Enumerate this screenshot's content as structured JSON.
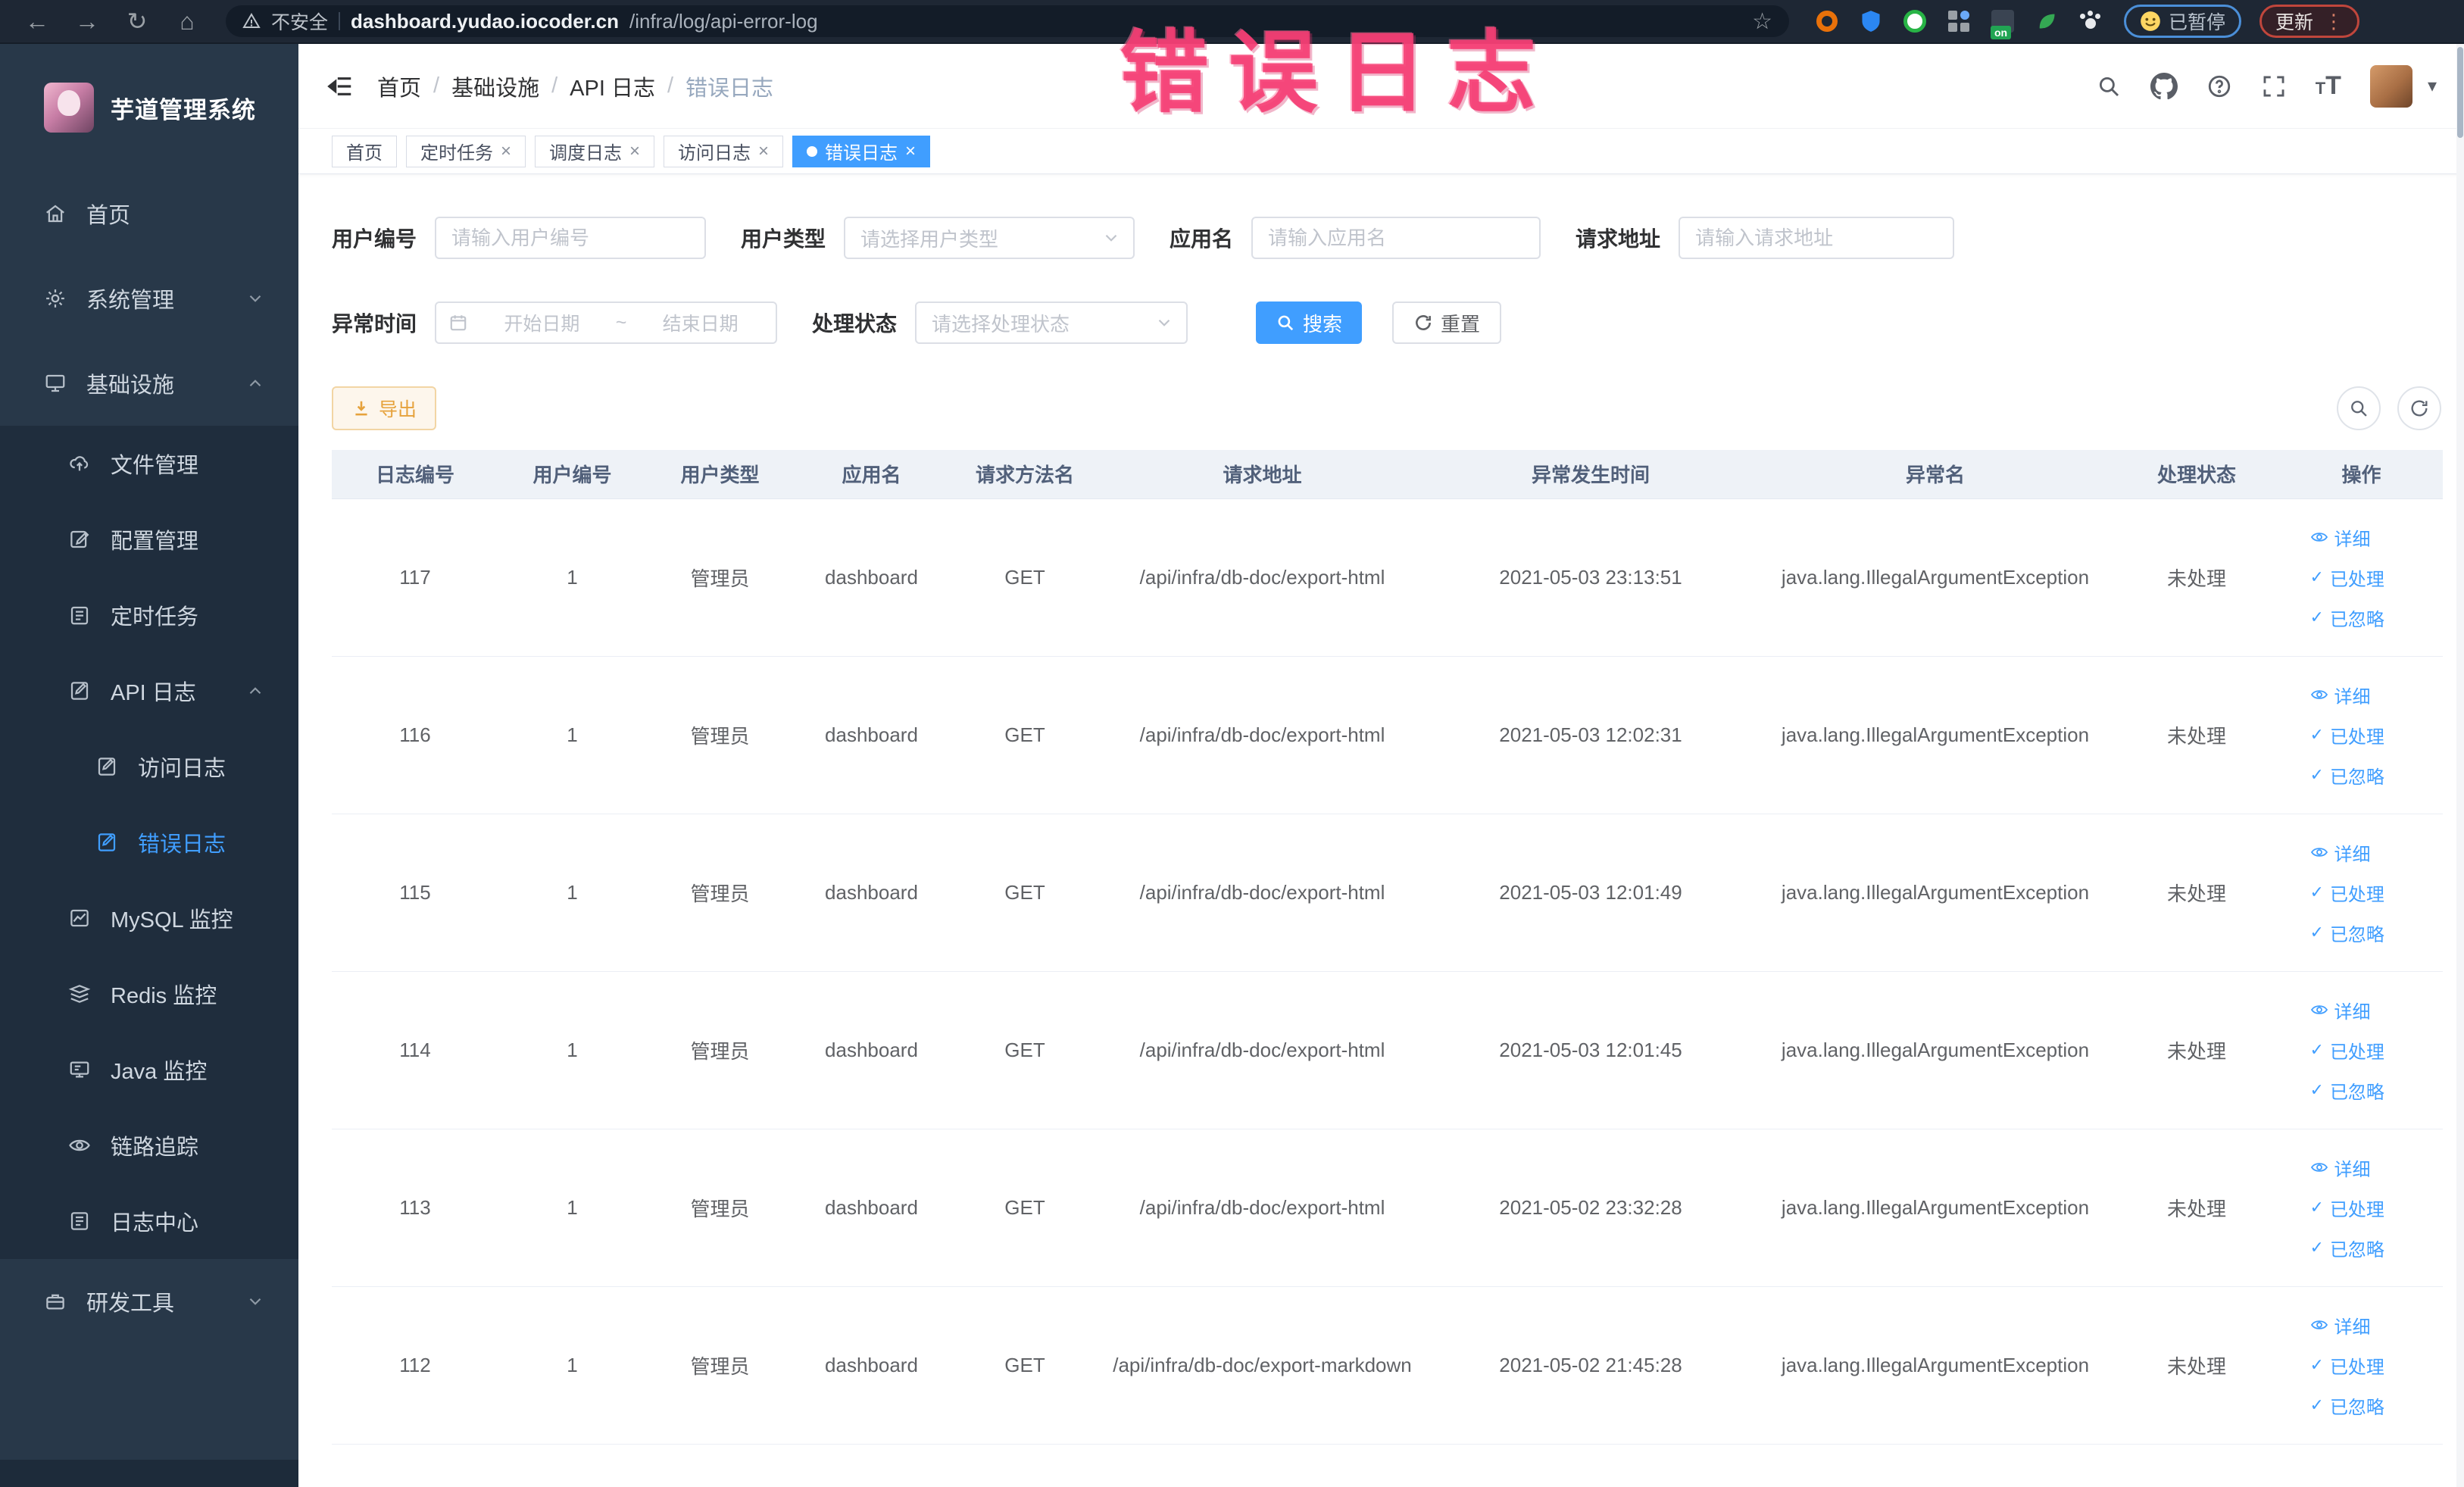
{
  "browser": {
    "security": "不安全",
    "url_domain": "dashboard.yudao.iocoder.cn",
    "url_path": "/infra/log/api-error-log",
    "on_badge": "on",
    "paused": "已暂停",
    "update": "更新"
  },
  "icons": {
    "back": "←",
    "forward": "→",
    "reload": "↻",
    "home": "⌂",
    "star": "☆",
    "close": "×",
    "check": "✓",
    "caret": "▾",
    "dots": "⋮",
    "slash": "/",
    "tilde": "~",
    "t_big": "T",
    "t_small": "T"
  },
  "annotation": {
    "text": "错误日志"
  },
  "sidebar": {
    "title": "芋道管理系统",
    "items": [
      {
        "label": "首页"
      },
      {
        "label": "系统管理"
      },
      {
        "label": "基础设施"
      },
      {
        "label": "文件管理"
      },
      {
        "label": "配置管理"
      },
      {
        "label": "定时任务"
      },
      {
        "label": "API 日志"
      },
      {
        "label": "访问日志"
      },
      {
        "label": "错误日志"
      },
      {
        "label": "MySQL 监控"
      },
      {
        "label": "Redis 监控"
      },
      {
        "label": "Java 监控"
      },
      {
        "label": "链路追踪"
      },
      {
        "label": "日志中心"
      },
      {
        "label": "研发工具"
      }
    ]
  },
  "topbar": {
    "crumbs": [
      "首页",
      "基础设施",
      "API 日志",
      "错误日志"
    ]
  },
  "tabs": [
    {
      "label": "首页"
    },
    {
      "label": "定时任务"
    },
    {
      "label": "调度日志"
    },
    {
      "label": "访问日志"
    },
    {
      "label": "错误日志"
    }
  ],
  "filters": {
    "user_id": {
      "label": "用户编号",
      "placeholder": "请输入用户编号"
    },
    "user_type": {
      "label": "用户类型",
      "placeholder": "请选择用户类型"
    },
    "app_name": {
      "label": "应用名",
      "placeholder": "请输入应用名"
    },
    "request_url": {
      "label": "请求地址",
      "placeholder": "请输入请求地址"
    },
    "time": {
      "label": "异常时间",
      "start": "开始日期",
      "end": "结束日期"
    },
    "status": {
      "label": "处理状态",
      "placeholder": "请选择处理状态"
    },
    "search": "搜索",
    "reset": "重置"
  },
  "toolbar": {
    "export": "导出"
  },
  "table": {
    "columns": [
      "日志编号",
      "用户编号",
      "用户类型",
      "应用名",
      "请求方法名",
      "请求地址",
      "异常发生时间",
      "异常名",
      "处理状态",
      "操作"
    ],
    "actions": {
      "detail": "详细",
      "done": "已处理",
      "ignore": "已忽略"
    },
    "rows": [
      {
        "id": "117",
        "user_id": "1",
        "user_type": "管理员",
        "app": "dashboard",
        "method": "GET",
        "url": "/api/infra/db-doc/export-html",
        "time": "2021-05-03 23:13:51",
        "exception": "java.lang.IllegalArgumentException",
        "status": "未处理"
      },
      {
        "id": "116",
        "user_id": "1",
        "user_type": "管理员",
        "app": "dashboard",
        "method": "GET",
        "url": "/api/infra/db-doc/export-html",
        "time": "2021-05-03 12:02:31",
        "exception": "java.lang.IllegalArgumentException",
        "status": "未处理"
      },
      {
        "id": "115",
        "user_id": "1",
        "user_type": "管理员",
        "app": "dashboard",
        "method": "GET",
        "url": "/api/infra/db-doc/export-html",
        "time": "2021-05-03 12:01:49",
        "exception": "java.lang.IllegalArgumentException",
        "status": "未处理"
      },
      {
        "id": "114",
        "user_id": "1",
        "user_type": "管理员",
        "app": "dashboard",
        "method": "GET",
        "url": "/api/infra/db-doc/export-html",
        "time": "2021-05-03 12:01:45",
        "exception": "java.lang.IllegalArgumentException",
        "status": "未处理"
      },
      {
        "id": "113",
        "user_id": "1",
        "user_type": "管理员",
        "app": "dashboard",
        "method": "GET",
        "url": "/api/infra/db-doc/export-html",
        "time": "2021-05-02 23:32:28",
        "exception": "java.lang.IllegalArgumentException",
        "status": "未处理"
      },
      {
        "id": "112",
        "user_id": "1",
        "user_type": "管理员",
        "app": "dashboard",
        "method": "GET",
        "url": "/api/infra/db-doc/export-markdown",
        "time": "2021-05-02 21:45:28",
        "exception": "java.lang.IllegalArgumentException",
        "status": "未处理"
      }
    ]
  }
}
